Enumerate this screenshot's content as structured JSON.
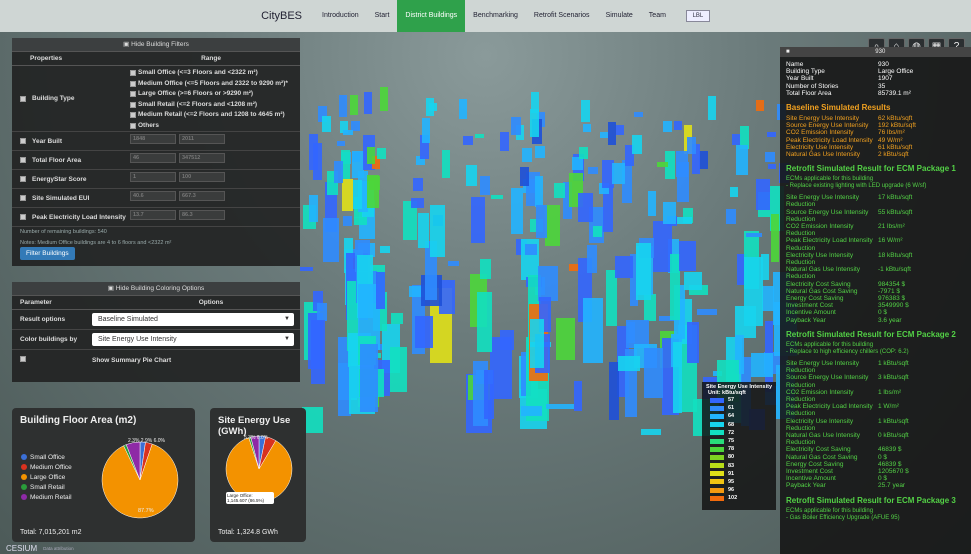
{
  "nav": {
    "brand": "CityBES",
    "items": [
      "Introduction",
      "Start",
      "District Buildings",
      "Benchmarking",
      "Retrofit Scenarios",
      "Simulate",
      "Team"
    ],
    "active": "District Buildings",
    "logo_label": "LBL"
  },
  "toolbar": [
    "search-icon",
    "home-icon",
    "globe-icon",
    "layers-icon",
    "help-icon"
  ],
  "filters": {
    "header": "Hide Building Filters",
    "col_properties": "Properties",
    "col_range": "Range",
    "building_type_label": "Building Type",
    "building_types": [
      "Small Office (<=3 Floors and <2322 m²)",
      "Medium Office (<=5 Floors and 2322 to 9290 m²)*",
      "Large Office (>=6 Floors or >9290 m²)",
      "Small Retail (<=2 Floors and <1208 m²)",
      "Medium Retail (<=2 Floors and 1208 to 4645 m²)",
      "Others"
    ],
    "rows": [
      {
        "label": "Year Built",
        "min": "1848",
        "max": "2011"
      },
      {
        "label": "Total Floor Area",
        "min": "46",
        "max": "347512"
      },
      {
        "label": "EnergyStar Score",
        "min": "1",
        "max": "100"
      },
      {
        "label": "Site Simulated EUI",
        "min": "40.6",
        "max": "667.3"
      },
      {
        "label": "Peak Electricity Load Intensity",
        "min": "13.7",
        "max": "86.3"
      }
    ],
    "note1": "Number of remaining buildings: 540",
    "note2": "Notes: Medium Office buildings are 4 to 6 floors and <2322 m²",
    "button": "Filter Buildings"
  },
  "coloring": {
    "header": "Hide Building Coloring Options",
    "col_parameter": "Parameter",
    "col_options": "Options",
    "result_label": "Result options",
    "result_value": "Baseline Simulated",
    "color_label": "Color buildings by",
    "color_value": "Site Energy Use Intensity",
    "pie_label": "Show Summary Pie Chart"
  },
  "pie_floor": {
    "title": "Building Floor Area (m2)",
    "total": "Total: 7,015,201 m2",
    "legend": [
      {
        "label": "Small Office",
        "color": "#3b6fd6"
      },
      {
        "label": "Medium Office",
        "color": "#d9321f"
      },
      {
        "label": "Large Office",
        "color": "#f39200"
      },
      {
        "label": "Small Retail",
        "color": "#2a9d3a"
      },
      {
        "label": "Medium Retail",
        "color": "#8e2aa6"
      }
    ],
    "slices": [
      2.3,
      2.9,
      87.7,
      1.2,
      5.9
    ],
    "main_label": "87.7%",
    "top_label": "2.3% 2.9% 6.0%"
  },
  "pie_site": {
    "title": "Site Energy Use (GWh)",
    "total": "Total: 1,324.8 GWh",
    "slices": [
      3.2,
      5.3,
      86.5,
      1.0,
      4.0
    ],
    "main_label": "86.5%",
    "top_label": "5.3% 6.0%",
    "tooltip": "Large Office: 1,145.607 (86.5%)"
  },
  "info": {
    "header_id": "930",
    "attributes": [
      {
        "k": "Name",
        "v": "930"
      },
      {
        "k": "Building Type",
        "v": "Large Office"
      },
      {
        "k": "Year Built",
        "v": "1907"
      },
      {
        "k": "Number of Stories",
        "v": "35"
      },
      {
        "k": "Total Floor Area",
        "v": "85739.1 m²"
      }
    ],
    "baseline_title": "Baseline Simulated Results",
    "baseline": [
      {
        "k": "Site Energy Use Intensity",
        "v": "62 kBtu/sqft"
      },
      {
        "k": "Source Energy Use Intensity",
        "v": "192 kBtu/sqft"
      },
      {
        "k": "CO2 Emission Intensity",
        "v": "76 lbs/m²"
      },
      {
        "k": "Peak Electricity Load Intensity",
        "v": "49 W/m²"
      },
      {
        "k": "Electricity Use Intensity",
        "v": "61 kBtu/sqft"
      },
      {
        "k": "Natural Gas Use Intensity",
        "v": "2 kBtu/sqft"
      }
    ],
    "ecm1_title": "Retrofit Simulated Result for ECM Package 1",
    "ecm1_note1": "ECMs applicable for this building",
    "ecm1_note2": "- Replace existing lighting with LED upgrade (6 W/sf)",
    "ecm1": [
      {
        "k": "Site Energy Use Intensity Reduction",
        "v": "17 kBtu/sqft"
      },
      {
        "k": "Source Energy Use Intensity Reduction",
        "v": "55 kBtu/sqft"
      },
      {
        "k": "CO2 Emission Intensity Reduction",
        "v": "21 lbs/m²"
      },
      {
        "k": "Peak Electricity Load Intensity Reduction",
        "v": "16 W/m²"
      },
      {
        "k": "Electricity Use Intensity Reduction",
        "v": "18 kBtu/sqft"
      },
      {
        "k": "Natural Gas Use Intensity Reduction",
        "v": "-1 kBtu/sqft"
      },
      {
        "k": "Electricity Cost Saving",
        "v": "984354 $"
      },
      {
        "k": "Natural Gas Cost Saving",
        "v": "-7971 $"
      },
      {
        "k": "Energy Cost Saving",
        "v": "976383 $"
      },
      {
        "k": "Investment Cost",
        "v": "3549990 $"
      },
      {
        "k": "Incentive Amount",
        "v": "0 $"
      },
      {
        "k": "Payback Year",
        "v": "3.6 year"
      }
    ],
    "ecm2_title": "Retrofit Simulated Result for ECM Package 2",
    "ecm2_note1": "ECMs applicable for this building",
    "ecm2_note2": "- Replace to high efficiency chillers (COP: 6.2)",
    "ecm2": [
      {
        "k": "Site Energy Use Intensity Reduction",
        "v": "1 kBtu/sqft"
      },
      {
        "k": "Source Energy Use Intensity Reduction",
        "v": "3 kBtu/sqft"
      },
      {
        "k": "CO2 Emission Intensity Reduction",
        "v": "1 lbs/m²"
      },
      {
        "k": "Peak Electricity Load Intensity Reduction",
        "v": "1 W/m²"
      },
      {
        "k": "Electricity Use Intensity Reduction",
        "v": "1 kBtu/sqft"
      },
      {
        "k": "Natural Gas Use Intensity Reduction",
        "v": "0 kBtu/sqft"
      },
      {
        "k": "Electricity Cost Saving",
        "v": "46839 $"
      },
      {
        "k": "Natural Gas Cost Saving",
        "v": "0 $"
      },
      {
        "k": "Energy Cost Saving",
        "v": "46839 $"
      },
      {
        "k": "Investment Cost",
        "v": "1205670 $"
      },
      {
        "k": "Incentive Amount",
        "v": "0 $"
      },
      {
        "k": "Payback Year",
        "v": "25.7 year"
      }
    ],
    "ecm3_title": "Retrofit Simulated Result for ECM Package 3",
    "ecm3_note1": "ECMs applicable for this building",
    "ecm3_note2": "- Gas Boiler Efficiency Upgrade (AFUE 95)"
  },
  "colorbar": {
    "title": "Site Energy Use Intensity",
    "unit": "Unit: kBtu/sqft",
    "entries": [
      {
        "v": "57",
        "c": "#3366ff"
      },
      {
        "v": "61",
        "c": "#2f8cff"
      },
      {
        "v": "64",
        "c": "#22b4ff"
      },
      {
        "v": "68",
        "c": "#17d4ee"
      },
      {
        "v": "72",
        "c": "#12e0c0"
      },
      {
        "v": "75",
        "c": "#28dd7a"
      },
      {
        "v": "78",
        "c": "#4cd63a"
      },
      {
        "v": "80",
        "c": "#7ed321"
      },
      {
        "v": "83",
        "c": "#b8dd18"
      },
      {
        "v": "91",
        "c": "#e0e018"
      },
      {
        "v": "95",
        "c": "#f2c512"
      },
      {
        "v": "96",
        "c": "#f59a10"
      },
      {
        "v": "102",
        "c": "#f26b0c"
      }
    ]
  },
  "footer": {
    "cesium": "CESIUM",
    "credits": "Data attribution"
  }
}
